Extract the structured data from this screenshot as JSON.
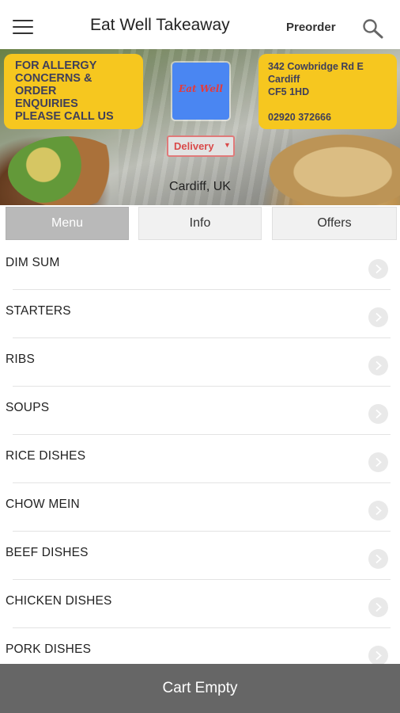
{
  "header": {
    "title": "Eat Well Takeaway",
    "preorder_label": "Preorder",
    "menu_icon": "hamburger-menu-icon",
    "search_icon": "search-icon"
  },
  "hero": {
    "allergy_lines": [
      "FOR ALLERGY",
      "CONCERNS &",
      "ORDER",
      "ENQUIRIES",
      "PLEASE CALL US"
    ],
    "address_lines": [
      "342 Cowbridge Rd E",
      "Cardiff",
      "CF5 1HD"
    ],
    "phone": "02920 372666",
    "logo_text": "Eat Well",
    "delivery_label": "Delivery",
    "location": "Cardiff, UK",
    "box_color": "#f6c71f",
    "logo_color": "#4a86f2"
  },
  "tabs": [
    {
      "label": "Menu",
      "active": true
    },
    {
      "label": "Info",
      "active": false
    },
    {
      "label": "Offers",
      "active": false
    }
  ],
  "menu": {
    "categories": [
      "DIM SUM",
      "STARTERS",
      "RIBS",
      "SOUPS",
      "RICE DISHES",
      "CHOW MEIN",
      "BEEF DISHES",
      "CHICKEN DISHES",
      "PORK DISHES"
    ],
    "row_icon": "chevron-right-icon"
  },
  "cart": {
    "label": "Cart Empty",
    "color": "#666666"
  }
}
